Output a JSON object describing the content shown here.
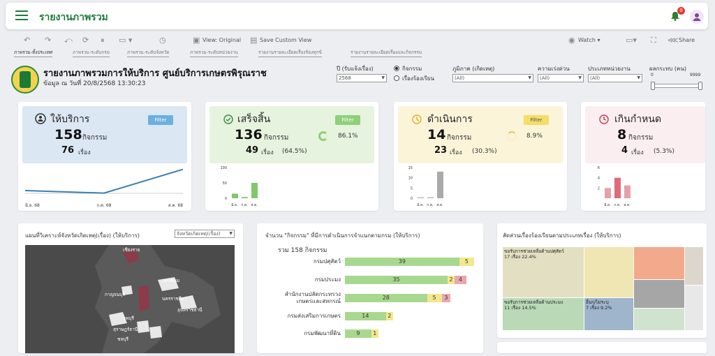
{
  "app": {
    "title": "รายงานภาพรวม",
    "notifications": "0"
  },
  "toolbar": {
    "view_original": "View: Original",
    "save_custom_view": "Save Custom View",
    "watch": "Watch ▾",
    "share": "Share"
  },
  "tabs": [
    {
      "label": "ภาพรวม-ทั้งประเทศ"
    },
    {
      "label": "ภาพรวม-ระดับกรม"
    },
    {
      "label": "ภาพรวม-ระดับจังหวัด"
    },
    {
      "label": "ภาพรวม-ระดับหน่วยงาน"
    },
    {
      "label": "รายงานรายละเอียดเรื่องร้องทุกข์"
    },
    {
      "label": "รายงานรายละเอียดเรื่องและกิจกรรม"
    }
  ],
  "header": {
    "title": "รายงานภาพรวมการให้บริการ ศูนย์บริการเกษตรพิรุณราช",
    "subtitle": "ข้อมูล ณ วันที่ 20/8/2568 13:30:23"
  },
  "filters": {
    "year_label": "ปี (รับแจ้งเรื่อง)",
    "year_value": "2568",
    "radio_activity": "กิจกรรม",
    "radio_complaint": "เรื่องร้องเรียน",
    "region_label": "ภูมิภาค (เกิดเหตุ)",
    "region_value": "(All)",
    "urgency_label": "ความเร่งด่วน",
    "urgency_value": "(All)",
    "agency_type_label": "ประเภทหน่วยงาน",
    "agency_type_value": "(All)",
    "impact_label": "ผลกระทบ (คน)",
    "impact_min": "0",
    "impact_max": "9999"
  },
  "kpis": [
    {
      "title": "ให้บริการ",
      "icon": "user-icon",
      "num": "158",
      "unit": "กิจกรรม",
      "num2": "76",
      "unit2": "เรื่อง",
      "filter": "Filter",
      "color": "#dbe7f3",
      "btn": "#6bb0de"
    },
    {
      "title": "เสร็จสิ้น",
      "icon": "check-circle-icon",
      "num": "136",
      "unit": "กิจกรรม",
      "pct": "86.1%",
      "num2": "49",
      "unit2": "เรื่อง",
      "pct2": "(64.5%)",
      "filter": "Filter",
      "color": "#e6f3de",
      "btn": "#8fd07a"
    },
    {
      "title": "ดำเนินการ",
      "icon": "progress-icon",
      "num": "14",
      "unit": "กิจกรรม",
      "pct": "8.9%",
      "num2": "23",
      "unit2": "เรื่อง",
      "pct2": "(30.3%)",
      "filter": "Filter",
      "color": "#fbf4d9",
      "btn": "#f4dd6a"
    },
    {
      "title": "เกินกำหนด",
      "icon": "clock-icon",
      "num": "8",
      "unit": "กิจกรรม",
      "num2": "4",
      "unit2": "เรื่อง",
      "pct2": "(5.3%)",
      "color": "#fbeef0"
    }
  ],
  "chart_data": [
    {
      "type": "line",
      "x": [
        "มิ.ย. 68",
        "ก.ค. 68",
        "ส.ค. 68"
      ],
      "values": [
        12,
        8,
        45
      ],
      "title": ""
    },
    {
      "type": "bar",
      "categories": [
        "มิ.ย.",
        "ก.ค.",
        "ส.ค."
      ],
      "values": [
        15,
        4,
        50
      ],
      "yticks": [
        "100",
        "50",
        "0"
      ],
      "title": ""
    },
    {
      "type": "bar",
      "categories": [
        "มิ.ย.",
        "ก.ค.",
        "ส.ค."
      ],
      "values": [
        0.5,
        0.5,
        13
      ],
      "yticks": [
        "15",
        "10",
        "5",
        "0"
      ],
      "title": ""
    },
    {
      "type": "bar",
      "categories": [
        "มิ.ย.",
        "ก.ค.",
        "ส.ค."
      ],
      "values": [
        2,
        4,
        2.5
      ],
      "yticks": [
        "6",
        "4",
        "2"
      ],
      "title": ""
    },
    {
      "type": "bar",
      "title": "จำนวน \"กิจกรรม\" ที่มีการดำเนินการจำแนกตามกรม (ให้บริการ)",
      "total_label": "รวม  158 กิจกรรม",
      "categories": [
        "กรมปศุสัตว์",
        "กรมประมง",
        "สำนักงานปลัดกระทรวง เกษตรและสหกรณ์",
        "กรมส่งเสริมการเกษตร",
        "กรมพัฒนาที่ดิน"
      ],
      "series": [
        {
          "values": [
            39,
            35,
            28,
            14,
            9
          ],
          "color": "#a8d88f"
        },
        {
          "values": [
            5,
            2,
            5,
            2,
            1
          ],
          "color": "#f3e88c"
        },
        {
          "values": [
            0,
            4,
            3,
            0,
            0
          ],
          "color": "#e8a8b0"
        }
      ]
    }
  ],
  "map": {
    "title": "แผนที่วิเคราะห์จังหวัดเกิดเหตุ(เรื่อง) (ให้บริการ)",
    "dropdown": "จังหวัดเกิดเหตุ(เรื่อง)",
    "labels": [
      "เชียงราย",
      "กาญจนบุรี",
      "นครราชสีมา",
      "นครพนม",
      "อุบลราชธานี",
      "ลพบุรี",
      "สุราษฎร์ธานี",
      "ชลบุรี"
    ]
  },
  "treemap": {
    "title": "สัดส่วนเรื่องร้องเรียนตามประเภทเรื่อง (ให้บริการ)",
    "cells": [
      {
        "label": "ขอรับการช่วยเหลือด้านปศุสัตว์",
        "value": "17 เรื่อง 22.4%",
        "color": "#e3dfc2"
      },
      {
        "label": "ขอรับการช่วยเหลือด้านประมง",
        "value": "11 เรื่อง 14.5%",
        "color": "#b9d9b7"
      },
      {
        "label": "อื่นๆ/ไม่ระบุ",
        "value": "7 เรื่อง 9.2%",
        "color": "#9fb5cc"
      }
    ]
  }
}
